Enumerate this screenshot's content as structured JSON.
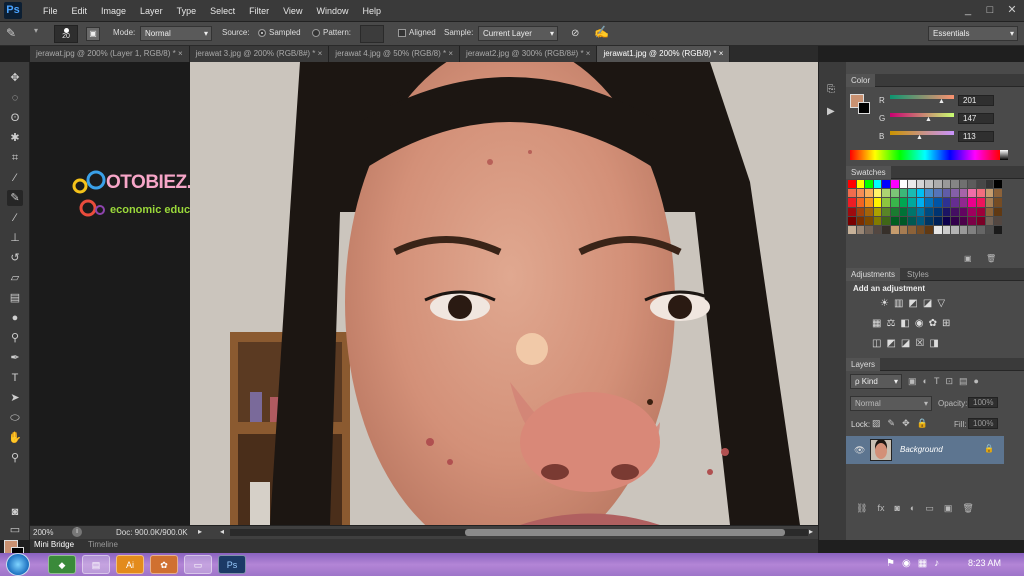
{
  "app": {
    "logo": "Ps"
  },
  "menu": [
    "File",
    "Edit",
    "Image",
    "Layer",
    "Type",
    "Select",
    "Filter",
    "View",
    "Window",
    "Help"
  ],
  "window_controls": {
    "minimize": "_",
    "maximize": "□",
    "close": "✕"
  },
  "options": {
    "brush_size": "20",
    "mode_label": "Mode:",
    "mode_value": "Normal",
    "source_label": "Source:",
    "sampled_label": "Sampled",
    "pattern_label": "Pattern:",
    "aligned_label": "Aligned",
    "sample_label": "Sample:",
    "sample_value": "Current Layer",
    "workspace": "Essentials"
  },
  "tabs": [
    {
      "label": "jerawat.jpg @ 200% (Layer 1, RGB/8) *",
      "active": false
    },
    {
      "label": "jerawat 3.jpg @ 200% (RGB/8#) *",
      "active": false
    },
    {
      "label": "jerawat 4.jpg @ 50% (RGB/8) *",
      "active": false
    },
    {
      "label": "jerawat2.jpg @ 300% (RGB/8#) *",
      "active": false
    },
    {
      "label": "jerawat1.jpg @ 200% (RGB/8) *",
      "active": true
    }
  ],
  "watermark": {
    "brand": "OTOBIEZ.COM",
    "tagline": "economic education"
  },
  "status": {
    "zoom": "200%",
    "doc": "Doc: 900.0K/900.0K"
  },
  "bottom_tabs": {
    "mini_bridge": "Mini Bridge",
    "timeline": "Timeline"
  },
  "colors": {
    "foreground": "#c99171",
    "background": "#000000"
  },
  "color_panel": {
    "title": "Color",
    "r_label": "R",
    "r_value": "201",
    "g_label": "G",
    "g_value": "147",
    "b_label": "B",
    "b_value": "113"
  },
  "swatches_panel": {
    "title": "Swatches"
  },
  "adjustments_panel": {
    "tab1": "Adjustments",
    "tab2": "Styles",
    "heading": "Add an adjustment"
  },
  "layers_panel": {
    "title": "Layers",
    "kind": "ρ Kind",
    "blend": "Normal",
    "opacity_label": "Opacity:",
    "opacity_value": "100%",
    "lock_label": "Lock:",
    "fill_label": "Fill:",
    "fill_value": "100%",
    "layer_name": "Background"
  },
  "taskbar": {
    "time": "8:23 AM"
  }
}
